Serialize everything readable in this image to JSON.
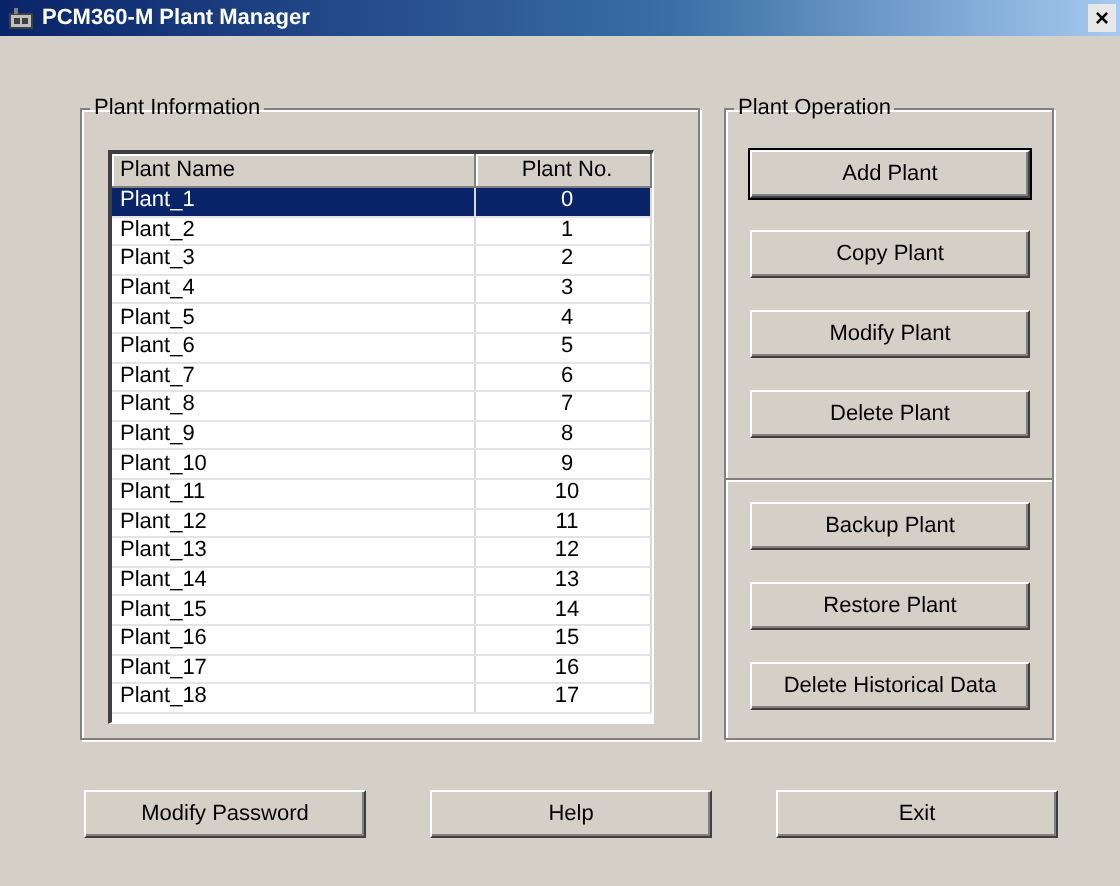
{
  "window": {
    "title": "PCM360-M Plant Manager",
    "close": "×"
  },
  "plant_information": {
    "title": "Plant Information",
    "columns": [
      "Plant Name",
      "Plant No."
    ],
    "rows": [
      {
        "name": "Plant_1",
        "number": "0",
        "selected": true
      },
      {
        "name": "Plant_2",
        "number": "1",
        "selected": false
      },
      {
        "name": "Plant_3",
        "number": "2",
        "selected": false
      },
      {
        "name": "Plant_4",
        "number": "3",
        "selected": false
      },
      {
        "name": "Plant_5",
        "number": "4",
        "selected": false
      },
      {
        "name": "Plant_6",
        "number": "5",
        "selected": false
      },
      {
        "name": "Plant_7",
        "number": "6",
        "selected": false
      },
      {
        "name": "Plant_8",
        "number": "7",
        "selected": false
      },
      {
        "name": "Plant_9",
        "number": "8",
        "selected": false
      },
      {
        "name": "Plant_10",
        "number": "9",
        "selected": false
      },
      {
        "name": "Plant_11",
        "number": "10",
        "selected": false
      },
      {
        "name": "Plant_12",
        "number": "11",
        "selected": false
      },
      {
        "name": "Plant_13",
        "number": "12",
        "selected": false
      },
      {
        "name": "Plant_14",
        "number": "13",
        "selected": false
      },
      {
        "name": "Plant_15",
        "number": "14",
        "selected": false
      },
      {
        "name": "Plant_16",
        "number": "15",
        "selected": false
      },
      {
        "name": "Plant_17",
        "number": "16",
        "selected": false
      },
      {
        "name": "Plant_18",
        "number": "17",
        "selected": false
      }
    ]
  },
  "plant_operation": {
    "title": "Plant Operation",
    "groups": [
      [
        {
          "label": "Add Plant",
          "default": true
        },
        {
          "label": "Copy Plant",
          "default": false
        },
        {
          "label": "Modify Plant",
          "default": false
        },
        {
          "label": "Delete Plant",
          "default": false
        }
      ],
      [
        {
          "label": "Backup Plant",
          "default": false
        },
        {
          "label": "Restore Plant",
          "default": false
        },
        {
          "label": "Delete Historical Data",
          "default": false
        }
      ]
    ]
  },
  "buttons": [
    "Modify Password",
    "Help",
    "Exit"
  ]
}
